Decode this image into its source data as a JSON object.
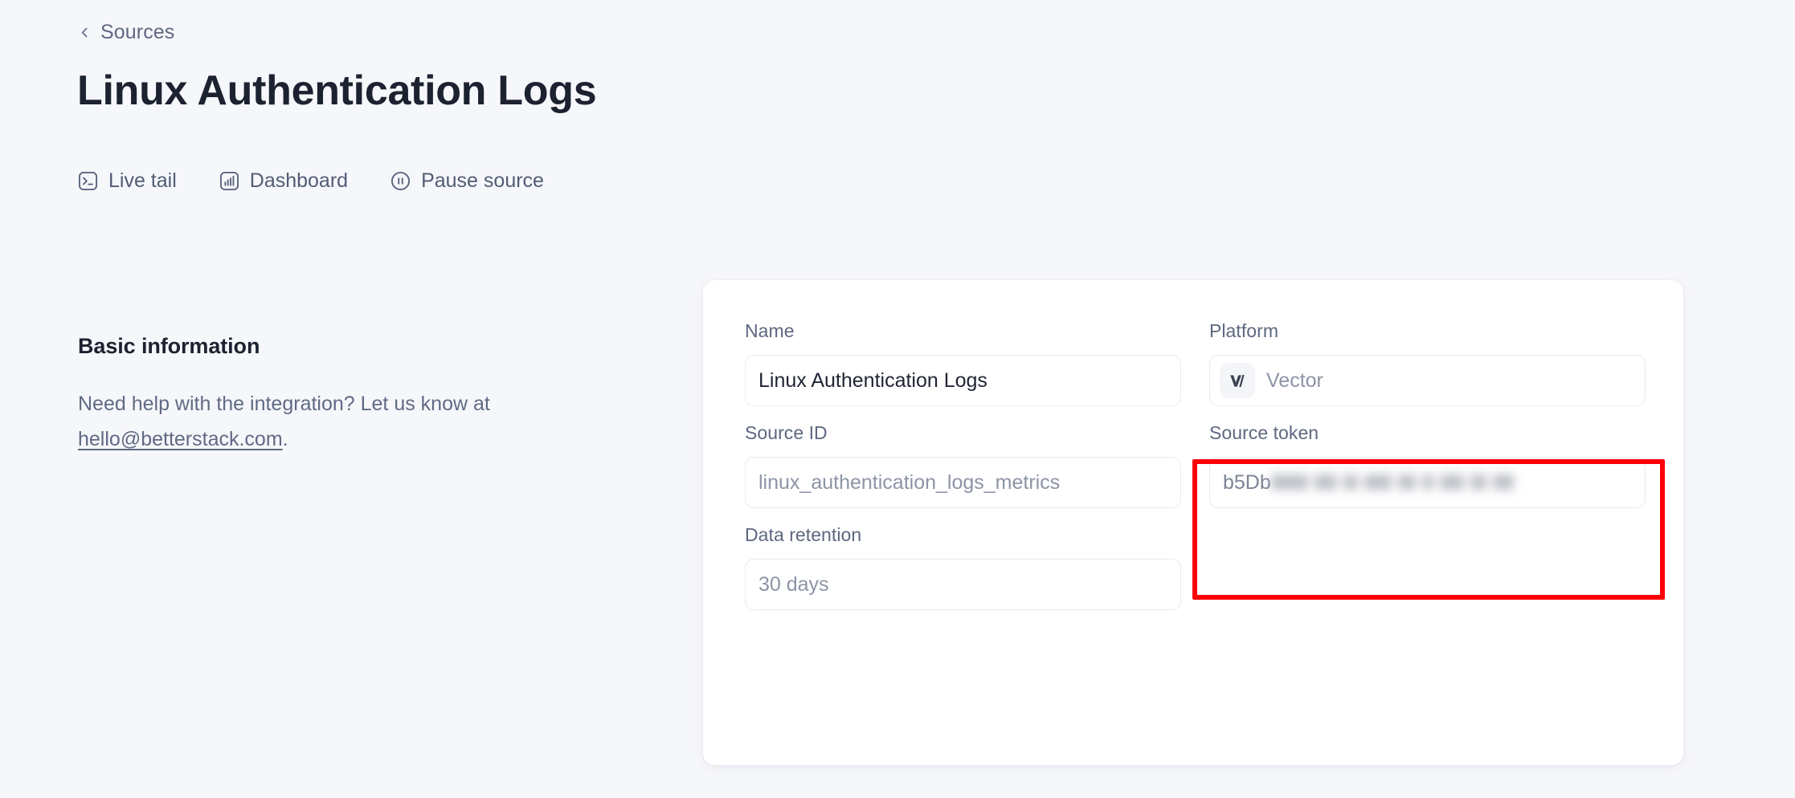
{
  "breadcrumb": {
    "icon": "chevron-left-icon",
    "label": "Sources"
  },
  "header": {
    "title": "Linux Authentication Logs"
  },
  "actions": [
    {
      "icon": "terminal-icon",
      "label": "Live tail"
    },
    {
      "icon": "bar-chart-icon",
      "label": "Dashboard"
    },
    {
      "icon": "pause-circle-icon",
      "label": "Pause source"
    }
  ],
  "info": {
    "heading": "Basic information",
    "body_prefix": "Need help with the integration? Let us know at ",
    "email": "hello@betterstack.com",
    "body_suffix": "."
  },
  "form": {
    "name": {
      "label": "Name",
      "value": "Linux Authentication Logs"
    },
    "platform": {
      "label": "Platform",
      "value": "Vector",
      "logo": "vector-logo-icon"
    },
    "source_id": {
      "label": "Source ID",
      "value": "linux_authentication_logs_metrics"
    },
    "source_token": {
      "label": "Source token",
      "value_visible": "b5Db",
      "value_redacted": true
    },
    "data_retention": {
      "label": "Data retention",
      "value": "30 days"
    }
  },
  "annotation": {
    "target": "source-token-field",
    "color": "#fb0007"
  },
  "colors": {
    "page_background": "#f6f7fa",
    "card_background": "#ffffff",
    "card_border": "#eceef3",
    "title_text": "#1c2230",
    "label_text": "#5d677f",
    "muted_text": "#8d94a6",
    "input_border": "#e8eaf0",
    "annotation_red": "#fb0007"
  }
}
